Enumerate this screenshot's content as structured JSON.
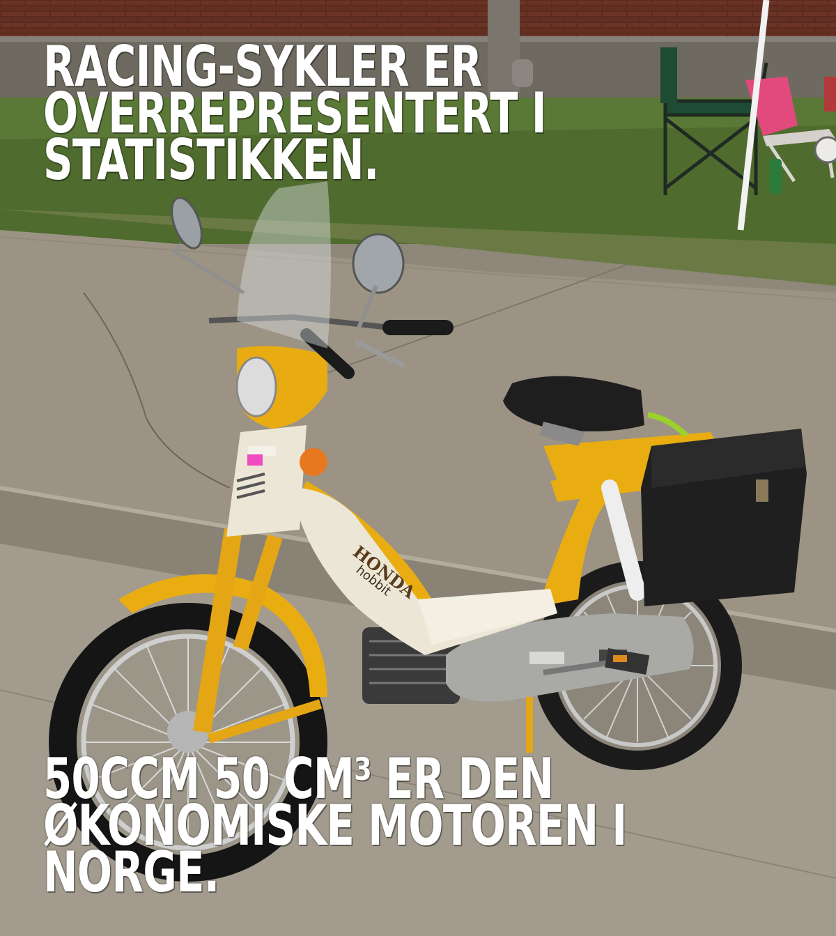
{
  "meme": {
    "top_lines": [
      "RACING-SYKLER ER",
      "OVERREPRESENTERT I",
      "STATISTIKKEN."
    ],
    "bottom_lines": [
      "50CCM 50 CM³ ER DEN",
      "ØKONOMISKE MOTOREN I",
      "NORGE."
    ]
  },
  "photo": {
    "subject": "yellow-and-white moped parked at a curb",
    "brand_badge": "HONDA",
    "model_badge": "hobbit",
    "colors": {
      "frame": "#e9ad12",
      "body_panel": "#ece6d6",
      "seat_and_bag": "#1c1c1c",
      "pavement": "#9d9485",
      "grass": "#4d6a2c",
      "brick": "#5b2b20"
    }
  }
}
